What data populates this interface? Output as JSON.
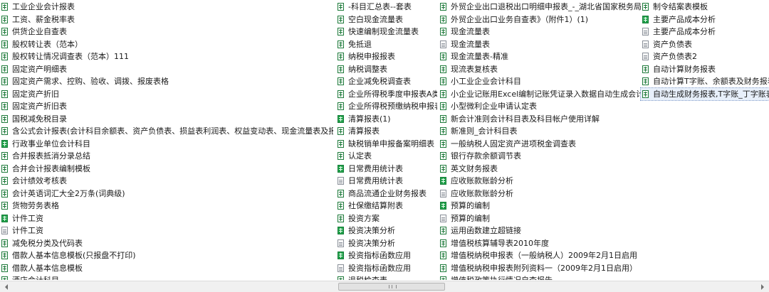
{
  "columns": [
    {
      "items": [
        {
          "name": "工业企业会计报表",
          "icon": "xls"
        },
        {
          "name": "工资、薪金税率表",
          "icon": "xls"
        },
        {
          "name": "供货企业自查表",
          "icon": "xls"
        },
        {
          "name": "股权转让表（范本）",
          "icon": "xls"
        },
        {
          "name": "股权转让情况调查表（范本）111",
          "icon": "xls"
        },
        {
          "name": "固定资产明细表",
          "icon": "xls"
        },
        {
          "name": "固定资产需求、控购、验收、调拨、报废表格",
          "icon": "xls"
        },
        {
          "name": "固定资产折旧",
          "icon": "xls"
        },
        {
          "name": "固定资产折旧表",
          "icon": "xls"
        },
        {
          "name": "国税减免税目录",
          "icon": "xls"
        },
        {
          "name": "含公式会计报表(会计科目余额表、资产负债表、损益表利润表、权益变动表、现金流量表及报表附表等)",
          "icon": "xls"
        },
        {
          "name": "行政事业单位会计科目",
          "icon": "xlsx"
        },
        {
          "name": "合并报表抵消分录总结",
          "icon": "xls"
        },
        {
          "name": "合并会计报表编制模板",
          "icon": "xls"
        },
        {
          "name": "会计绩效考核表",
          "icon": "xls"
        },
        {
          "name": "会计英语词汇大全2万条(词典级)",
          "icon": "xls"
        },
        {
          "name": "货物劳务表格",
          "icon": "xls"
        },
        {
          "name": "计件工资",
          "icon": "xlsx"
        },
        {
          "name": "计件工资",
          "icon": "txt"
        },
        {
          "name": "减免税分类及代码表",
          "icon": "xls"
        },
        {
          "name": "借款人基本信息模板(只报盘不打印)",
          "icon": "xls"
        },
        {
          "name": "借款人基本信息模板",
          "icon": "xls"
        },
        {
          "name": "酒店会计科目",
          "icon": "xls"
        }
      ]
    },
    {
      "items": [
        {
          "name": "-科目汇总表--套表",
          "icon": "xls"
        },
        {
          "name": "空白现金流量表",
          "icon": "xls"
        },
        {
          "name": "快速编制现金流量表",
          "icon": "xls"
        },
        {
          "name": "免抵退",
          "icon": "xls"
        },
        {
          "name": "纳税申报报表",
          "icon": "xls"
        },
        {
          "name": "纳税调整表",
          "icon": "xls"
        },
        {
          "name": "企业减免税调查表",
          "icon": "xls"
        },
        {
          "name": "企业所得税季度申报表A类",
          "icon": "xls"
        },
        {
          "name": "企业所得税预缴纳税申报表",
          "icon": "xls"
        },
        {
          "name": "清算报表(1)",
          "icon": "xlsx"
        },
        {
          "name": "清算报表",
          "icon": "xls"
        },
        {
          "name": "缺税销单申报备案明细表",
          "icon": "xls"
        },
        {
          "name": "认定表",
          "icon": "xls"
        },
        {
          "name": "日常费用统计表",
          "icon": "xlsx"
        },
        {
          "name": "日常费用统计表",
          "icon": "txt"
        },
        {
          "name": "商品流通企业财务报表",
          "icon": "xls"
        },
        {
          "name": "社保缴结算附表",
          "icon": "xls"
        },
        {
          "name": "投资方案",
          "icon": "xls"
        },
        {
          "name": "投资决策分析",
          "icon": "xlsx"
        },
        {
          "name": "投资决策分析",
          "icon": "txt"
        },
        {
          "name": "投资指标函数应用",
          "icon": "xlsx"
        },
        {
          "name": "投资指标函数应用",
          "icon": "txt"
        },
        {
          "name": "退税检查表",
          "icon": "xls"
        }
      ]
    },
    {
      "items": [
        {
          "name": "外贸企业出口退税出口明细申报表_-_湖北省国家税务局外网",
          "icon": "xls"
        },
        {
          "name": "外贸企业出口业务自查表》（附件1）(1)",
          "icon": "xls"
        },
        {
          "name": "现金流量表",
          "icon": "xls"
        },
        {
          "name": "现金流量表",
          "icon": "txt"
        },
        {
          "name": "现金流量表-精准",
          "icon": "xls"
        },
        {
          "name": "现流表复核表",
          "icon": "xls"
        },
        {
          "name": "小工业企业会计科目",
          "icon": "xls"
        },
        {
          "name": "小企业记账用Excel编制记账凭证录入数据自动生成会计报表",
          "icon": "xls"
        },
        {
          "name": "小型微利企业申请认定表",
          "icon": "xls"
        },
        {
          "name": "新会计准则会计科目表及科目帐户使用详解",
          "icon": "xls"
        },
        {
          "name": "新准则_会计科目表",
          "icon": "xls"
        },
        {
          "name": "一般纳税人固定资产进项税金调查表",
          "icon": "xls"
        },
        {
          "name": "银行存款余额调节表",
          "icon": "xls"
        },
        {
          "name": "英文财务报表",
          "icon": "xls"
        },
        {
          "name": "应收账款账龄分析",
          "icon": "xlsx"
        },
        {
          "name": "应收账款账龄分析",
          "icon": "txt"
        },
        {
          "name": "预算的编制",
          "icon": "xlsx"
        },
        {
          "name": "预算的编制",
          "icon": "txt"
        },
        {
          "name": "运用函数建立超链接",
          "icon": "xls"
        },
        {
          "name": "增值税核算辅导表2010年度",
          "icon": "xls"
        },
        {
          "name": "增值税纳税申报表（一般纳税人）2009年2月1日启用",
          "icon": "xls"
        },
        {
          "name": "增值税纳税申报表附列资料一（2009年2月1日启用）",
          "icon": "xls"
        },
        {
          "name": "增值税政策执行情况自查报告",
          "icon": "xls"
        }
      ]
    },
    {
      "items": [
        {
          "name": "制令结案表模板",
          "icon": "xls"
        },
        {
          "name": "主要产品成本分析",
          "icon": "xlsx"
        },
        {
          "name": "主要产品成本分析",
          "icon": "txt"
        },
        {
          "name": "资产负债表",
          "icon": "txt"
        },
        {
          "name": "资产负债表2",
          "icon": "txt"
        },
        {
          "name": "自动计算财务报表",
          "icon": "xls"
        },
        {
          "name": "自动计算T字账、余额表及财务报表",
          "icon": "xls"
        },
        {
          "name": "自动生成财务报表,T字账_丁字账表_凭证",
          "icon": "xls",
          "selected": true
        }
      ]
    }
  ],
  "scrollbar": {
    "left_arrow_icon": "chevron-left-icon",
    "right_arrow_icon": "chevron-right-icon",
    "thumb_grip_icon": "grip-icon"
  }
}
